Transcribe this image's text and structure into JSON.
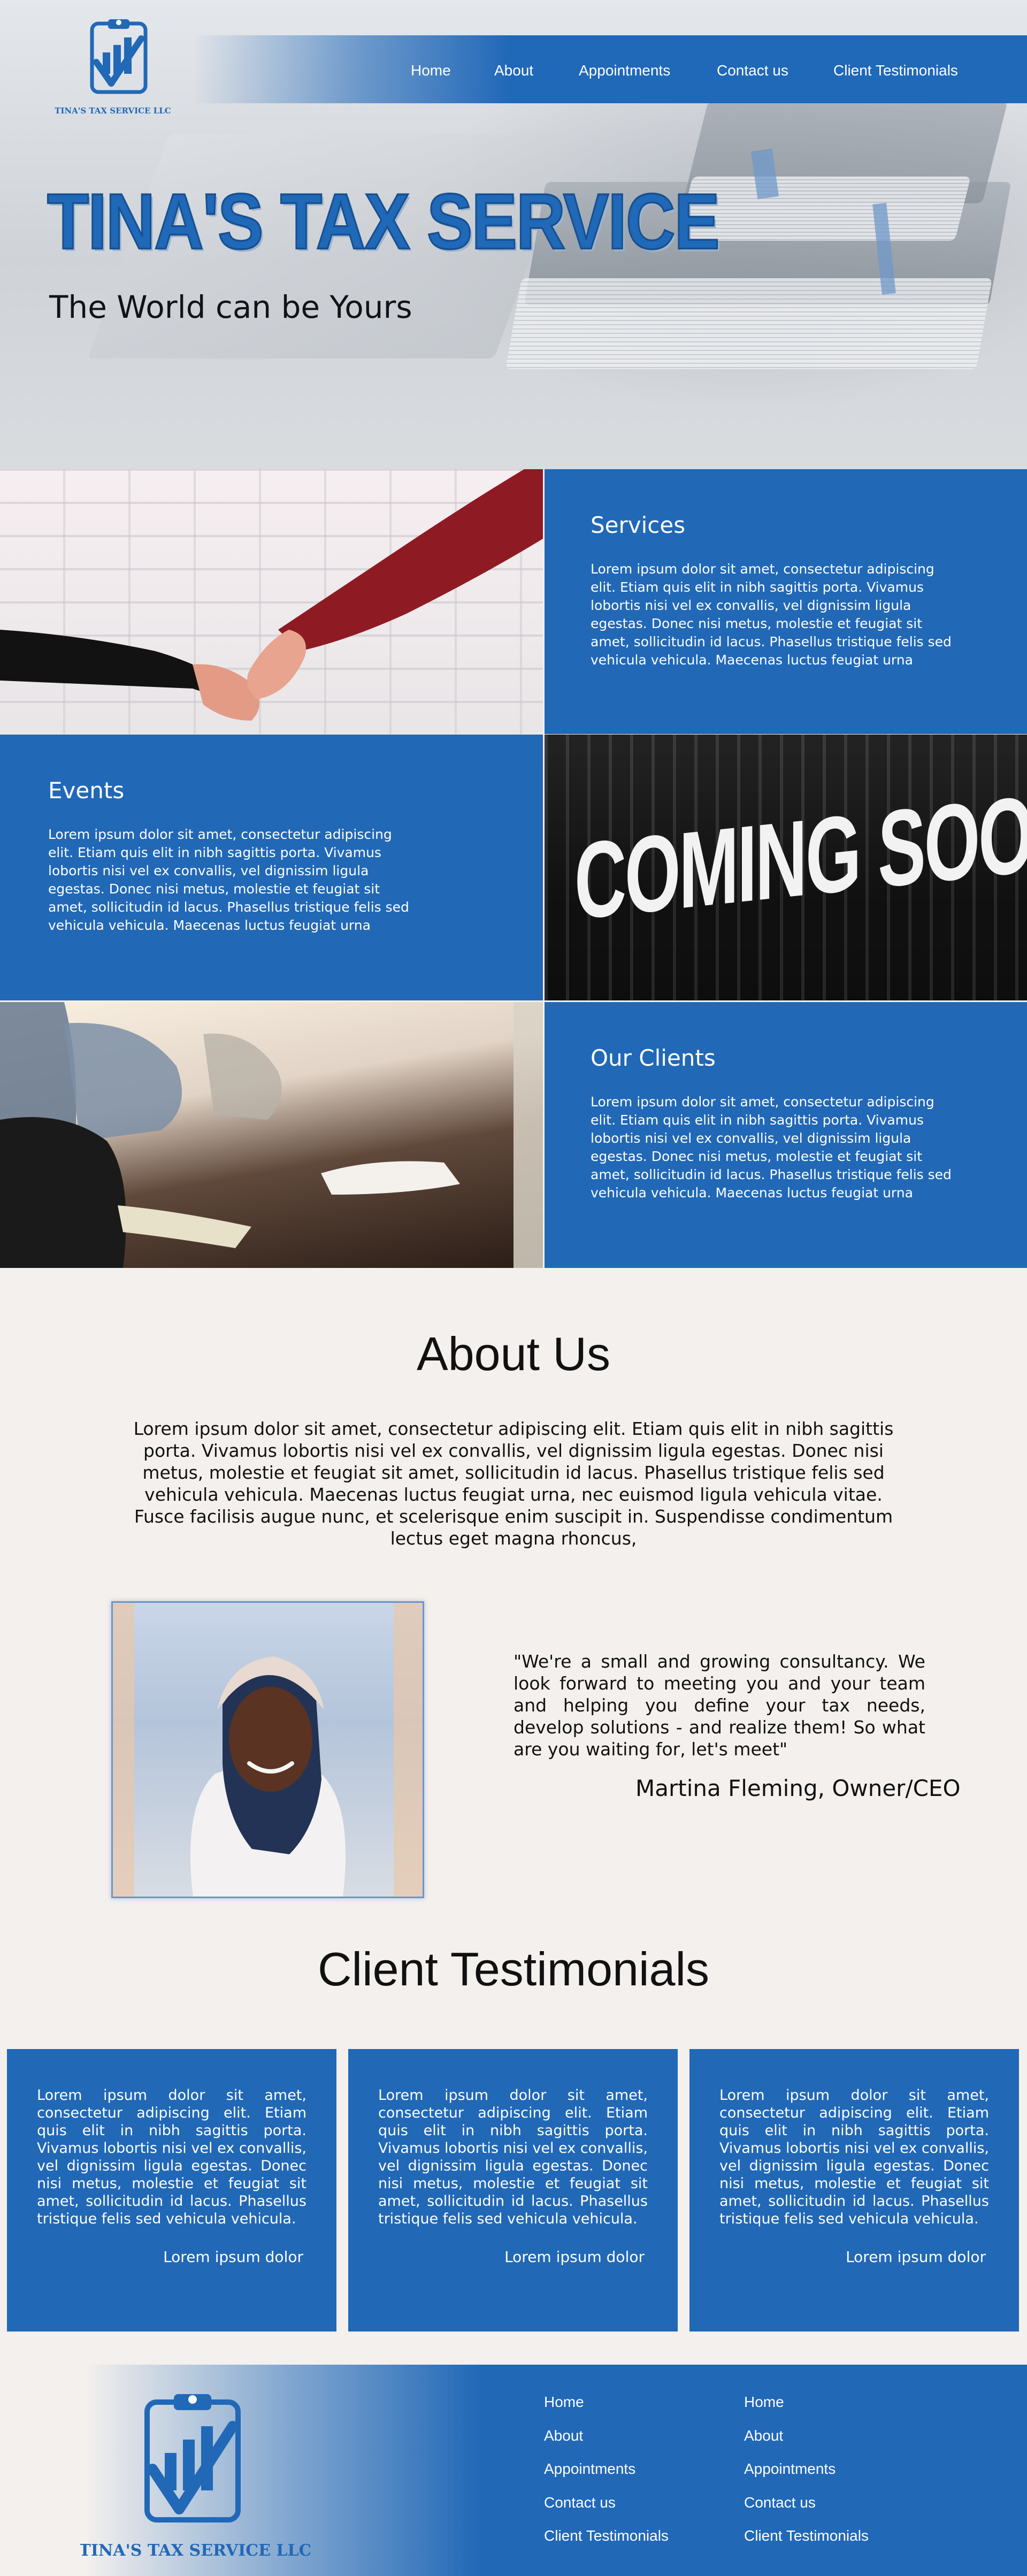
{
  "brand": {
    "logo_text": "TINA'S TAX SERVICE LLC",
    "primary_color": "#2168b7"
  },
  "nav": {
    "items": [
      "Home",
      "About",
      "Appointments",
      "Contact us",
      "Client Testimonials"
    ]
  },
  "hero": {
    "title": "TINA'S TAX SERVICE",
    "subtitle": "The World can be Yours"
  },
  "features": [
    {
      "heading": "Services",
      "text": "Lorem ipsum dolor sit amet, consectetur adipiscing elit. Etiam quis elit in nibh sagittis porta. Vivamus lobortis nisi vel ex convallis, vel dignissim ligula egestas. Donec nisi metus, molestie et feugiat sit amet, sollicitudin id lacus. Phasellus tristique felis sed vehicula vehicula. Maecenas luctus feugiat urna"
    },
    {
      "heading": "Events",
      "text": "Lorem ipsum dolor sit amet, consectetur adipiscing elit. Etiam quis elit in nibh sagittis porta. Vivamus lobortis nisi vel ex convallis, vel dignissim ligula egestas. Donec nisi metus, molestie et feugiat sit amet, sollicitudin id lacus. Phasellus tristique felis sed vehicula vehicula. Maecenas luctus feugiat urna"
    },
    {
      "heading": "Our Clients",
      "text": "Lorem ipsum dolor sit amet, consectetur adipiscing elit. Etiam quis elit in nibh sagittis porta. Vivamus lobortis nisi vel ex convallis, vel dignissim ligula egestas. Donec nisi metus, molestie et feugiat sit amet, sollicitudin id lacus. Phasellus tristique felis sed vehicula vehicula. Maecenas luctus feugiat urna"
    }
  ],
  "coming_soon_image_text": "COMING SOON",
  "about": {
    "title": "About Us",
    "text": "Lorem ipsum dolor sit amet, consectetur adipiscing elit. Etiam quis elit in nibh sagittis porta. Vivamus lobortis nisi vel ex convallis, vel dignissim ligula egestas. Donec nisi metus, molestie et feugiat sit amet, sollicitudin id lacus. Phasellus tristique felis sed vehicula vehicula. Maecenas luctus feugiat urna, nec euismod ligula vehicula vitae. Fusce facilisis augue nunc, et scelerisque enim suscipit in. Suspendisse condimentum lectus eget magna rhoncus,",
    "quote": "\"We're a small and growing consultancy. We look forward to meeting you and your team and helping you define your tax needs, develop solutions - and realize them! So what are you waiting for, let's meet\"",
    "quote_author": "Martina Fleming, Owner/CEO"
  },
  "testimonials": {
    "title": "Client Testimonials",
    "cards": [
      {
        "text": "Lorem ipsum dolor sit amet, consectetur adipiscing elit. Etiam quis elit in nibh sagittis porta. Vivamus lobortis nisi vel ex convallis, vel dignissim ligula egestas. Donec nisi metus, molestie et feugiat sit amet, sollicitudin id lacus. Phasellus tristique felis sed vehicula vehicula.",
        "author": "Lorem ipsum dolor"
      },
      {
        "text": "Lorem ipsum dolor sit amet, consectetur adipiscing elit. Etiam quis elit in nibh sagittis porta. Vivamus lobortis nisi vel ex convallis, vel dignissim ligula egestas. Donec nisi metus, molestie et feugiat sit amet, sollicitudin id lacus. Phasellus tristique felis sed vehicula vehicula.",
        "author": "Lorem ipsum dolor"
      },
      {
        "text": "Lorem ipsum dolor sit amet, consectetur adipiscing elit. Etiam quis elit in nibh sagittis porta. Vivamus lobortis nisi vel ex convallis, vel dignissim ligula egestas. Donec nisi metus, molestie et feugiat sit amet, sollicitudin id lacus. Phasellus tristique felis sed vehicula vehicula.",
        "author": "Lorem ipsum dolor"
      }
    ]
  },
  "footer": {
    "column_1": [
      "Home",
      "About",
      "Appointments",
      "Contact us",
      "Client Testimonials"
    ],
    "column_2": [
      "Home",
      "About",
      "Appointments",
      "Contact us",
      "Client Testimonials"
    ]
  }
}
